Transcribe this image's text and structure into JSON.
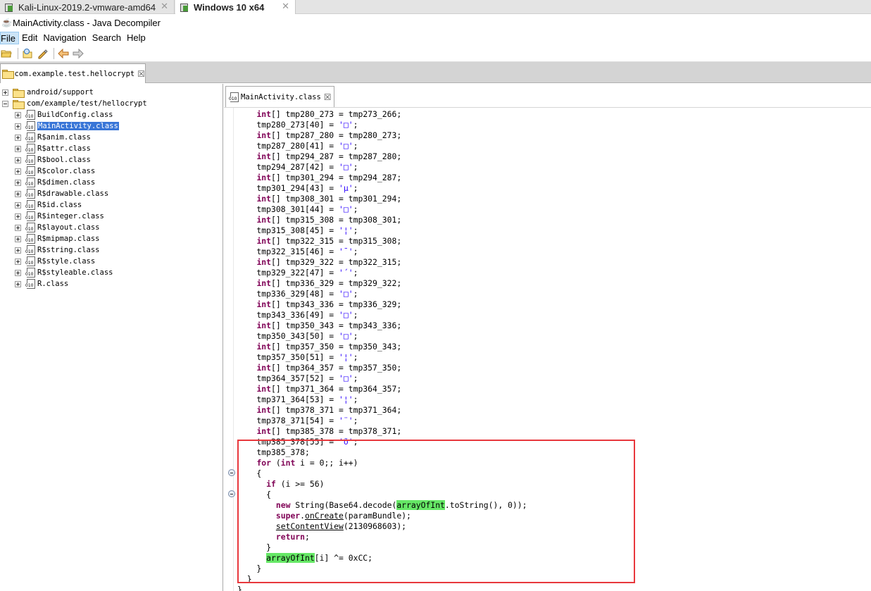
{
  "vm_tabs": [
    {
      "label": "Kali-Linux-2019.2-vmware-amd64"
    },
    {
      "label": "Windows 10 x64"
    }
  ],
  "window": {
    "title": "MainActivity.class - Java Decompiler"
  },
  "menu": [
    "File",
    "Edit",
    "Navigation",
    "Search",
    "Help"
  ],
  "toolbar": [
    {
      "icon": "open-folder-icon"
    },
    {
      "icon": "open-type-icon"
    },
    {
      "icon": "search-icon"
    },
    {
      "icon": "back-arrow-icon"
    },
    {
      "icon": "forward-arrow-icon"
    }
  ],
  "package_tab": {
    "label": "com.example.test.hellocrypt",
    "close": "☒"
  },
  "tree": {
    "roots": [
      "android/support",
      "com/example/test/hellocrypt"
    ],
    "classes": [
      "BuildConfig.class",
      "MainActivity.class",
      "R$anim.class",
      "R$attr.class",
      "R$bool.class",
      "R$color.class",
      "R$dimen.class",
      "R$drawable.class",
      "R$id.class",
      "R$integer.class",
      "R$layout.class",
      "R$mipmap.class",
      "R$string.class",
      "R$style.class",
      "R$styleable.class",
      "R.class"
    ],
    "selected": "MainActivity.class"
  },
  "editor_tab": {
    "label": "MainActivity.class",
    "close": "☒"
  },
  "code_lines": [
    "    int[] tmp280_273 = tmp273_266;",
    "    tmp280_273[40] = '\u001d';",
    "    int[] tmp287_280 = tmp280_273;",
    "    tmp287_280[41] = '\u001a';",
    "    int[] tmp294_287 = tmp287_280;",
    "    tmp294_287[42] = '\u0015';",
    "    int[] tmp301_294 = tmp294_287;",
    "    tmp301_294[43] = 'µ';",
    "    int[] tmp308_301 = tmp301_294;",
    "    tmp308_301[44] = '\u0018';",
    "    int[] tmp315_308 = tmp308_301;",
    "    tmp315_308[45] = '¦';",
    "    int[] tmp322_315 = tmp315_308;",
    "    tmp322_315[46] = '¯';",
    "    int[] tmp329_322 = tmp322_315;",
    "    tmp329_322[47] = '´';",
    "    int[] tmp336_329 = tmp329_322;",
    "    tmp336_329[48] = '\u0019';",
    "    int[] tmp343_336 = tmp336_329;",
    "    tmp343_336[49] = '\u0016';",
    "    int[] tmp350_343 = tmp343_336;",
    "    tmp350_343[50] = '\u0017';",
    "    int[] tmp357_350 = tmp350_343;",
    "    tmp357_350[51] = '¦';",
    "    int[] tmp364_357 = tmp357_350;",
    "    tmp364_357[52] = '\u001b';",
    "    int[] tmp371_364 = tmp364_357;",
    "    tmp371_364[53] = '¦';",
    "    int[] tmp378_371 = tmp371_364;",
    "    tmp378_371[54] = '¨';",
    "    int[] tmp385_378 = tmp378_371;",
    "    tmp385_378[55] = 'õ';",
    "    tmp385_378;",
    "    for (int i = 0;; i++)",
    "    {",
    "      if (i >= 56)",
    "      {",
    "        new String(Base64.decode(arrayOfInt.toString(), 0));",
    "        super.onCreate(paramBundle);",
    "        setContentView(2130968603);",
    "        return;",
    "      }",
    "      arrayOfInt[i] ^= 0xCC;",
    "    }",
    "  }",
    "}"
  ],
  "colors": {
    "keyword": "#7f0055",
    "string": "#2a00ff",
    "highlight": "#66e866",
    "selection": "#3875d7",
    "annotation_box": "#e8383d"
  }
}
